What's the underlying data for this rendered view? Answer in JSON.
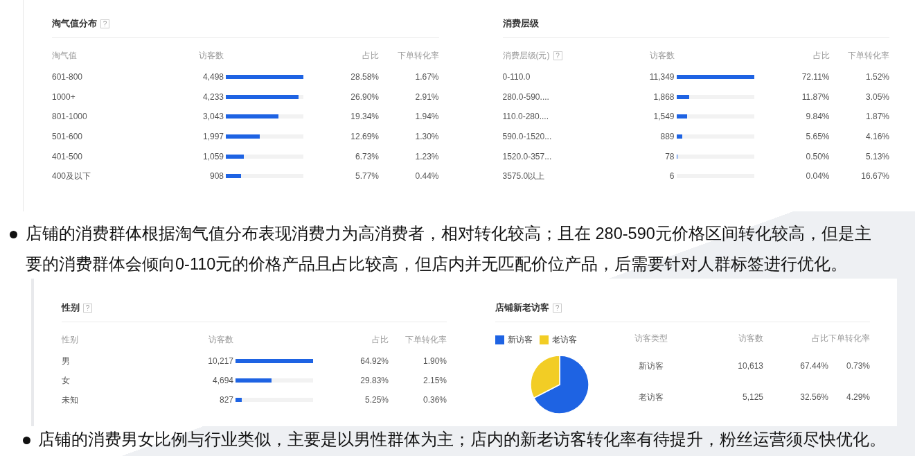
{
  "top_panels": [
    {
      "title": "淘气值分布",
      "help": "?",
      "columns": [
        {
          "label": "淘气值"
        },
        {
          "label": "访客数"
        },
        {
          "label": "占比"
        },
        {
          "label": "下单转化率"
        }
      ],
      "rows": [
        {
          "label": "601-800",
          "visitors": "4,498",
          "level": 1.0,
          "share": "28.58%",
          "rate": "1.67%"
        },
        {
          "label": "1000+",
          "visitors": "4,233",
          "level": 0.94,
          "share": "26.90%",
          "rate": "2.91%"
        },
        {
          "label": "801-1000",
          "visitors": "3,043",
          "level": 0.68,
          "share": "19.34%",
          "rate": "1.94%"
        },
        {
          "label": "501-600",
          "visitors": "1,997",
          "level": 0.44,
          "share": "12.69%",
          "rate": "1.30%"
        },
        {
          "label": "401-500",
          "visitors": "1,059",
          "level": 0.23,
          "share": "6.73%",
          "rate": "1.23%"
        },
        {
          "label": "400及以下",
          "visitors": "908",
          "level": 0.2,
          "share": "5.77%",
          "rate": "0.44%"
        }
      ]
    },
    {
      "title": "消费层级",
      "columns": [
        {
          "label": "消费层级(元)",
          "help": "?"
        },
        {
          "label": "访客数"
        },
        {
          "label": "占比"
        },
        {
          "label": "下单转化率"
        }
      ],
      "rows": [
        {
          "label": "0-110.0",
          "visitors": "11,349",
          "level": 1.0,
          "share": "72.11%",
          "rate": "1.52%"
        },
        {
          "label": "280.0-590....",
          "visitors": "1,868",
          "level": 0.165,
          "share": "11.87%",
          "rate": "3.05%"
        },
        {
          "label": "110.0-280....",
          "visitors": "1,549",
          "level": 0.137,
          "share": "9.84%",
          "rate": "1.87%"
        },
        {
          "label": "590.0-1520...",
          "visitors": "889",
          "level": 0.078,
          "share": "5.65%",
          "rate": "4.16%"
        },
        {
          "label": "1520.0-357...",
          "visitors": "78",
          "level": 0.007,
          "share": "0.50%",
          "rate": "5.13%"
        },
        {
          "label": "3575.0以上",
          "visitors": "6",
          "level": 0.0005,
          "share": "0.04%",
          "rate": "16.67%"
        }
      ]
    }
  ],
  "note_1": "店铺的消费群体根据淘气值分布表现消费力为高消费者，相对转化较高；且在 280-590元价格区间转化较高，但是主要的消费群体会倾向0-110元的价格产品且占比较高，但店内并无匹配价位产品，后需要针对人群标签进行优化。",
  "gender_panel": {
    "title": "性别",
    "help": "?",
    "columns": [
      {
        "label": "性别"
      },
      {
        "label": "访客数"
      },
      {
        "label": "占比"
      },
      {
        "label": "下单转化率"
      }
    ],
    "rows": [
      {
        "label": "男",
        "visitors": "10,217",
        "level": 1.0,
        "share": "64.92%",
        "rate": "1.90%"
      },
      {
        "label": "女",
        "visitors": "4,694",
        "level": 0.46,
        "share": "29.83%",
        "rate": "2.15%"
      },
      {
        "label": "未知",
        "visitors": "827",
        "level": 0.08,
        "share": "5.25%",
        "rate": "0.36%"
      }
    ]
  },
  "visitor_panel": {
    "title": "店铺新老访客",
    "help": "?",
    "legend": [
      {
        "label": "新访客",
        "color": "#1e63e3"
      },
      {
        "label": "老访客",
        "color": "#f2cd25"
      }
    ],
    "chart_data": {
      "type": "pie",
      "values": [
        67.44,
        32.56
      ]
    },
    "columns": [
      {
        "label": "访客类型"
      },
      {
        "label": "访客数"
      },
      {
        "label": "占比"
      },
      {
        "label": "下单转化率"
      }
    ],
    "rows": [
      {
        "label": "新访客",
        "visitors": "10,613",
        "share": "67.44%",
        "rate": "0.73%"
      },
      {
        "label": "老访客",
        "visitors": "5,125",
        "share": "32.56%",
        "rate": "4.29%"
      }
    ]
  },
  "note_2": "店铺的消费男女比例与行业类似，主要是以男性群体为主；店内的新老访客转化率有待提升，粉丝运营须尽快优化。"
}
